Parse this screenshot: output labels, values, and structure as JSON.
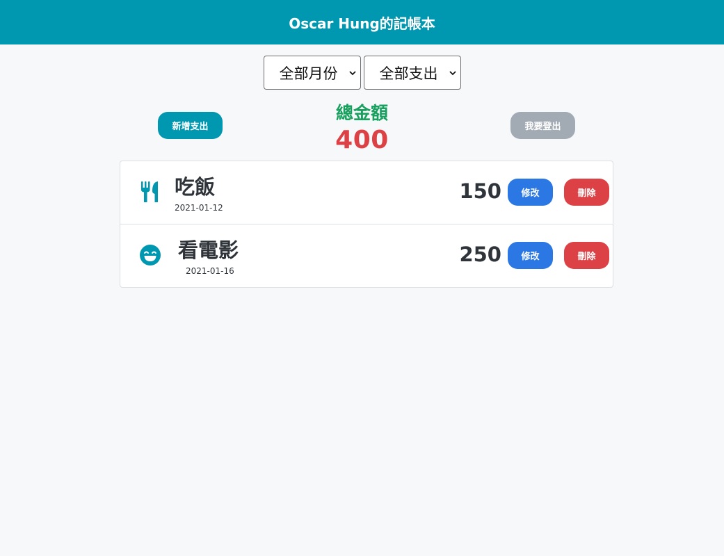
{
  "header": {
    "title": "Oscar Hung的記帳本"
  },
  "filters": {
    "month": {
      "selected": "全部月份"
    },
    "category": {
      "selected": "全部支出"
    }
  },
  "summary": {
    "add_label": "新增支出",
    "total_label": "總金額",
    "total_value": "400",
    "logout_label": "我要登出"
  },
  "expenses": [
    {
      "icon": "utensils-icon",
      "name": "吃飯",
      "date": "2021-01-12",
      "amount": "150",
      "edit_label": "修改",
      "delete_label": "刪除"
    },
    {
      "icon": "grin-icon",
      "name": "看電影",
      "date": "2021-01-16",
      "amount": "250",
      "edit_label": "修改",
      "delete_label": "刪除"
    }
  ],
  "colors": {
    "primary": "#0097b0",
    "total_label": "#17a05e",
    "total_value": "#dc4145",
    "edit": "#2b78e4",
    "delete": "#dc4145",
    "logout": "#a2aab3"
  }
}
